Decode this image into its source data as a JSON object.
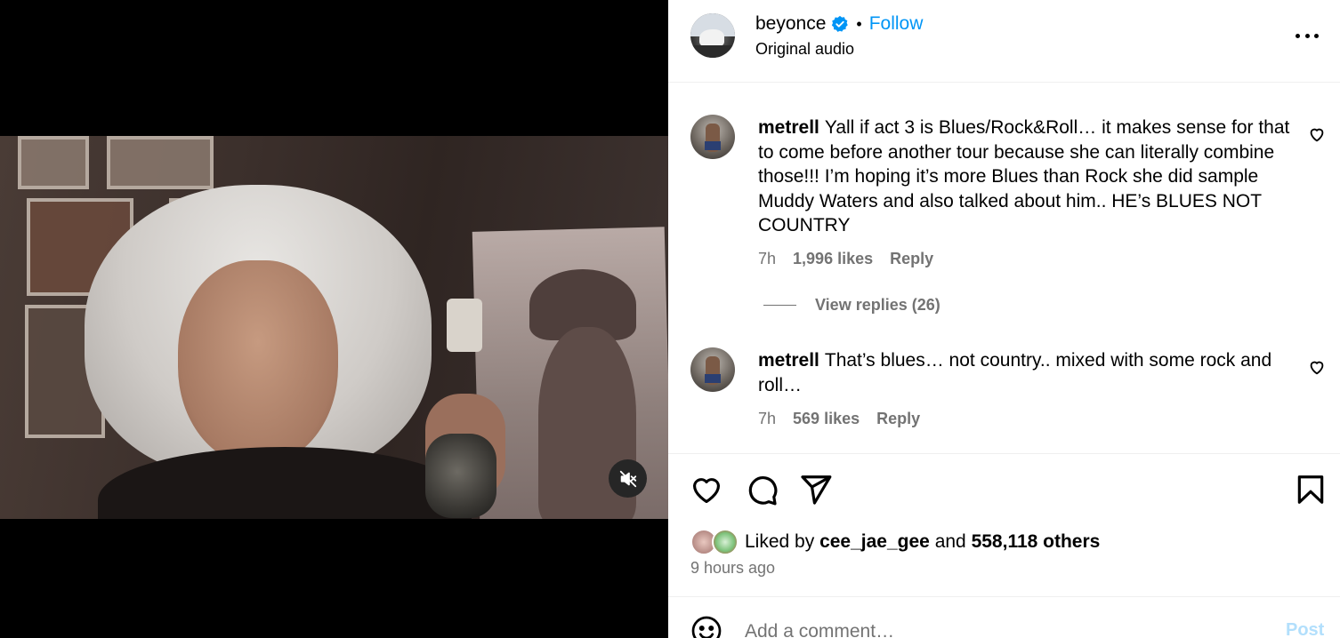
{
  "post": {
    "username": "beyonce",
    "verified_icon": "verified-badge-icon",
    "separator": "•",
    "follow_label": "Follow",
    "audio_label": "Original audio"
  },
  "comments": [
    {
      "author": "metrell",
      "text": "Yall if act 3 is Blues/Rock&Roll… it makes sense for that to come before another tour because she can literally combine those!!! I’m hoping it’s more Blues than Rock she did sample Muddy Waters and also talked about him.. HE’s BLUES NOT COUNTRY",
      "time": "7h",
      "likes": "1,996 likes",
      "reply_label": "Reply"
    },
    {
      "author": "metrell",
      "text": "That’s blues… not country.. mixed with some rock and roll…",
      "time": "7h",
      "likes": "569 likes",
      "reply_label": "Reply"
    }
  ],
  "view_replies": "View replies (26)",
  "engagement": {
    "liked_by_prefix": "Liked by",
    "liked_by_user": "cee_jae_gee",
    "liked_by_and": "and",
    "liked_by_count": "558,118 others",
    "time_ago": "9 hours ago"
  },
  "composer": {
    "placeholder": "Add a comment…",
    "post_label": "Post"
  },
  "colors": {
    "accent": "#0095f6",
    "muted": "#737373",
    "post_disabled": "#b2dffc"
  }
}
